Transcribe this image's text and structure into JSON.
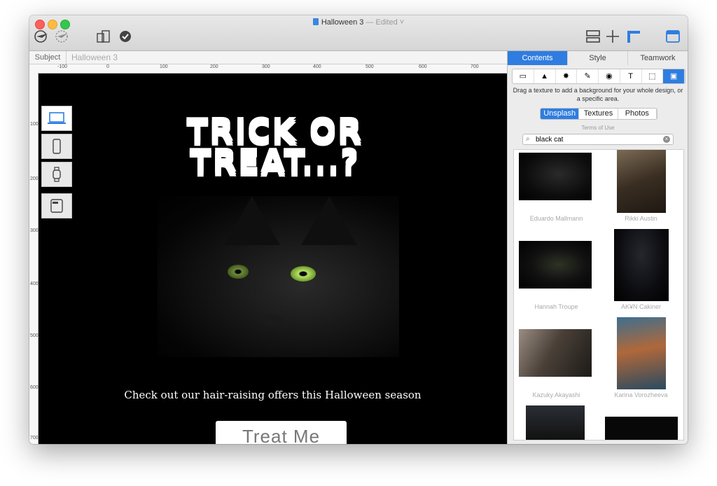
{
  "window": {
    "title": "Halloween 3",
    "edited_label": "— Edited ˅"
  },
  "subject": {
    "label": "Subject",
    "value": "Halloween 3"
  },
  "ruler": {
    "labels": [
      "-100",
      "0",
      "100",
      "200",
      "300",
      "400",
      "500",
      "600",
      "700"
    ],
    "vlabels": [
      "100",
      "200",
      "300",
      "400",
      "500",
      "600",
      "700"
    ]
  },
  "canvas": {
    "headline_line1": "TRICK OR",
    "headline_line2": "TREAT...?",
    "tagline": "Check out our hair-raising offers this Halloween season",
    "cta_label": "Treat Me"
  },
  "panel": {
    "tabs": [
      {
        "label": "Contents",
        "active": true
      },
      {
        "label": "Style",
        "active": false
      },
      {
        "label": "Teamwork",
        "active": false
      }
    ],
    "tools": [
      "▭",
      "▲",
      "✸",
      "✎",
      "◉",
      "T",
      "⬚",
      "▣"
    ],
    "hint": "Drag a texture to add a background for your whole design, or a specific area.",
    "sources": [
      {
        "label": "Unsplash",
        "active": true
      },
      {
        "label": "Textures",
        "active": false
      },
      {
        "label": "Photos",
        "active": false
      }
    ],
    "terms": "Terms of Use",
    "search_value": "black cat",
    "results": [
      {
        "credit": "Eduardo Mallmann"
      },
      {
        "credit": "Rikki Austin"
      },
      {
        "credit": "Hannah Troupe"
      },
      {
        "credit": "AK¥N Cakiner"
      },
      {
        "credit": "Kazuky Akayashi"
      },
      {
        "credit": "Karina Vorozheeva"
      }
    ]
  },
  "colors": {
    "accent": "#2f7de0",
    "canvas_bg": "#000000",
    "eye_green": "#b9e26a"
  }
}
